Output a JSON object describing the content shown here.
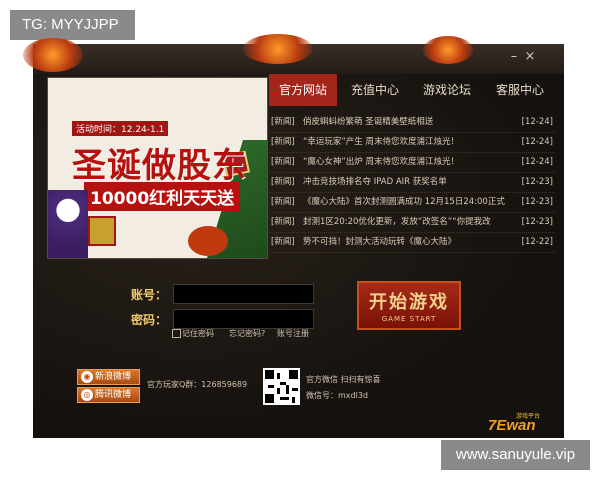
{
  "watermarks": {
    "top_left": "TG: MYYJJPP",
    "bottom_right": "www.sanuyule.vip"
  },
  "window": {
    "minimize_label": "–",
    "close_label": "×"
  },
  "banner": {
    "date_label": "活动时间：12.24-1.1",
    "title": "圣诞做股东",
    "subtitle": "10000红利天天送"
  },
  "tabs": [
    {
      "label": "官方网站",
      "active": true
    },
    {
      "label": "充值中心",
      "active": false
    },
    {
      "label": "游戏论坛",
      "active": false
    },
    {
      "label": "客服中心",
      "active": false
    }
  ],
  "news": [
    {
      "category": "[新闻]",
      "text": "俏皮蝌蚪纷繁萌 圣诞精美壁纸相送",
      "date": "[12-24]"
    },
    {
      "category": "[新闻]",
      "text": "“幸运玩家”产生 周末侍您欢度浦江烛光！",
      "date": "[12-24]"
    },
    {
      "category": "[新闻]",
      "text": "“魔心女神”出炉 周末侍您欢度浦江烛光！",
      "date": "[12-24]"
    },
    {
      "category": "[新闻]",
      "text": "冲击竞技场排名夺 IPAD AIR 获奖名单",
      "date": "[12-23]"
    },
    {
      "category": "[新闻]",
      "text": "《魔心大陆》首次封测圆满成功 12月15日24:00正式",
      "date": "[12-23]"
    },
    {
      "category": "[新闻]",
      "text": "封测1区20:20优化更新，发放“改签名”“你提我改",
      "date": "[12-23]"
    },
    {
      "category": "[新闻]",
      "text": "势不可挡！封测大活动玩转《魔心大陆》",
      "date": "[12-22]"
    }
  ],
  "login": {
    "account_label": "账号：",
    "password_label": "密码：",
    "account_value": "",
    "password_value": "",
    "remember_label": "记住密码",
    "forgot_label": "忘记密码?",
    "register_label": "账号注册"
  },
  "start_button": {
    "main": "开始游戏",
    "sub": "GAME START"
  },
  "social": {
    "weibo_sina": "新浪微博",
    "weibo_tencent": "腾讯微博",
    "weibo_sina_icon": "sina-weibo-icon",
    "weibo_tencent_icon": "tencent-weibo-icon"
  },
  "footer": {
    "qq_group": "官方玩家Q群：126859689",
    "wechat_line1": "官方微信 扫扫有惊喜",
    "wechat_line2": "微信号：mxdl3d"
  },
  "logo": {
    "top": "游戏平台",
    "main": "7Ewan"
  },
  "colors": {
    "accent_red": "#a4261a",
    "gold_label": "#f0c868",
    "frame_dark": "#171310"
  }
}
